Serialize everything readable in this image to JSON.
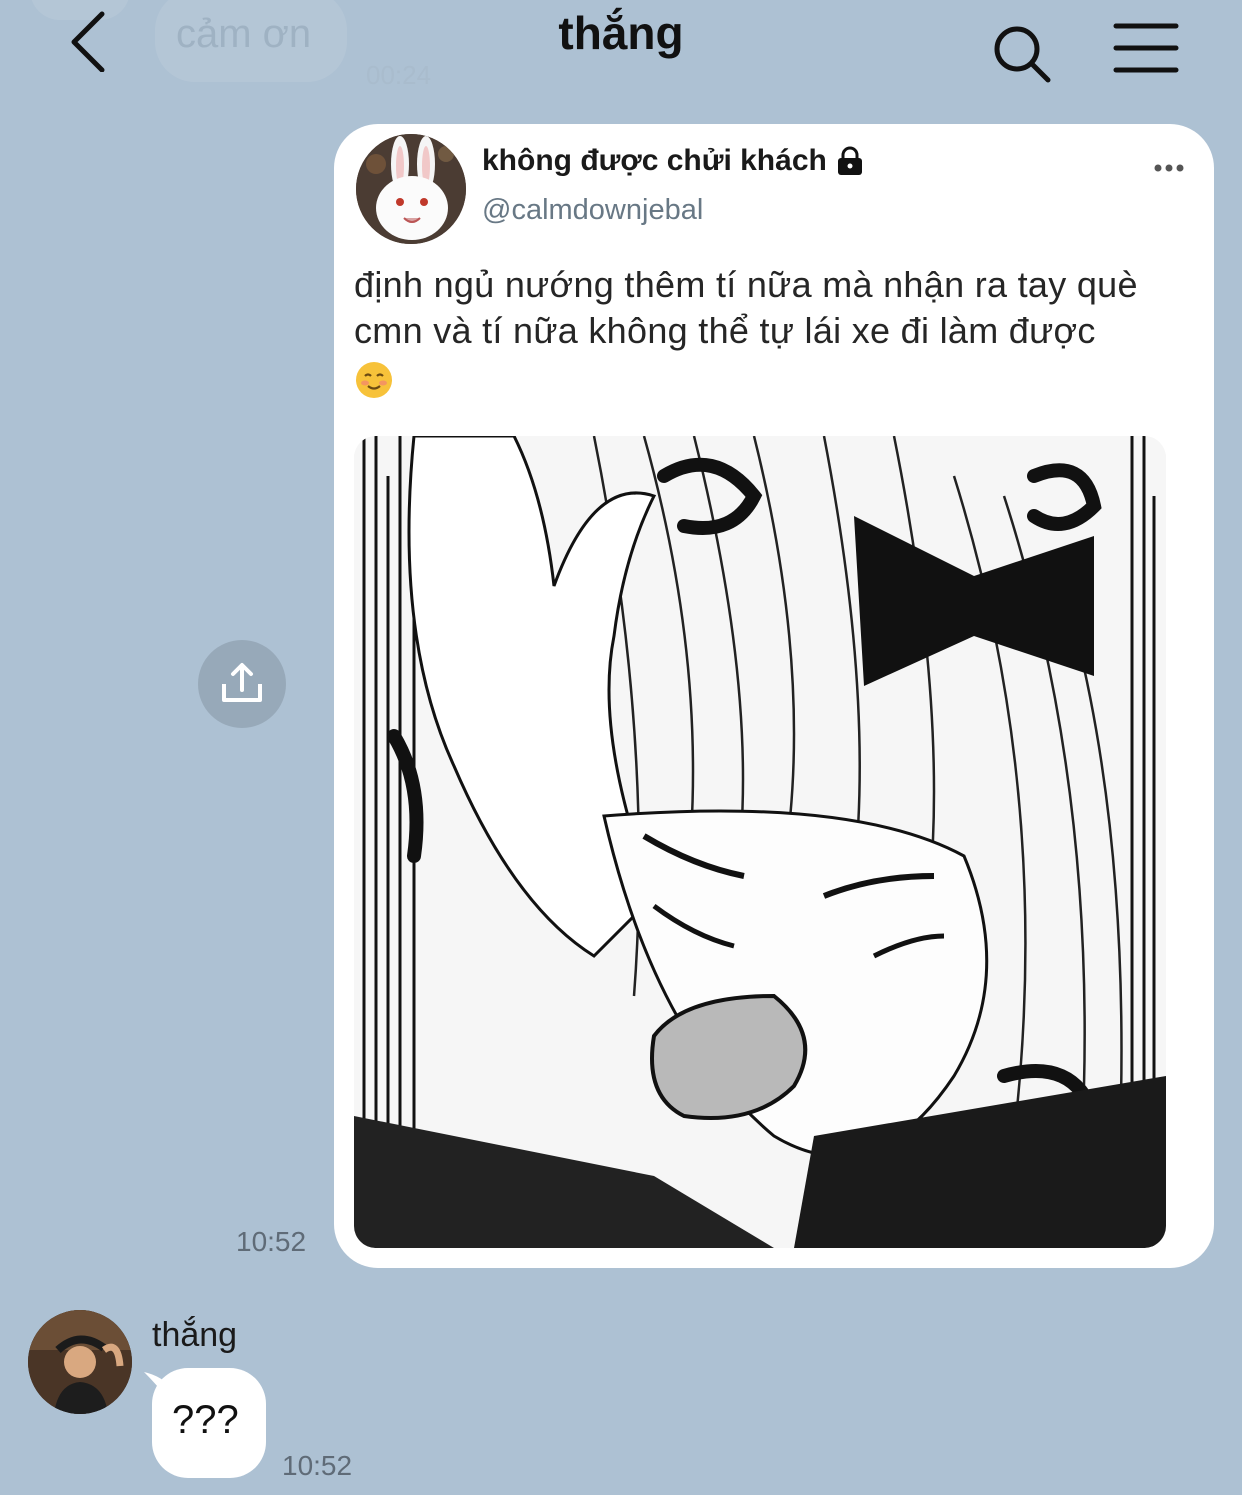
{
  "header": {
    "title": "thắng",
    "back_icon": "chevron-left-icon",
    "search_icon": "search-icon",
    "menu_icon": "hamburger-menu-icon"
  },
  "previous_message": {
    "text": "cảm ơn",
    "time": "00:24"
  },
  "shared_post": {
    "time": "10:52",
    "share_icon": "share-upload-icon",
    "tweet": {
      "display_name": "không được chửi khách",
      "handle": "@calmdownjebal",
      "text": "định ngủ nướng thêm tí nữa mà nhận ra tay què cmn và tí nữa không thể tự lái xe đi làm được",
      "emoji": "☺️",
      "image_description_icon": "manga-image"
    }
  },
  "incoming_message": {
    "sender": "thắng",
    "text": "???",
    "time": "10:52"
  },
  "colors": {
    "background": "#adc1d3",
    "bubble": "#ffffff",
    "time_text": "#5f6b77"
  }
}
